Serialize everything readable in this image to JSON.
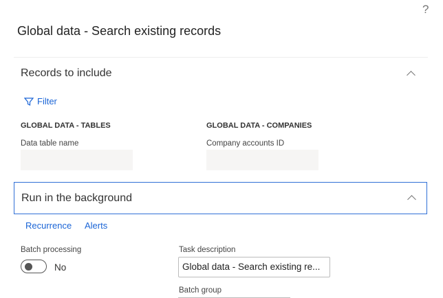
{
  "help_label": "?",
  "title": "Global data - Search existing records",
  "records": {
    "title": "Records to include",
    "filter": "Filter",
    "tables": {
      "group": "GLOBAL DATA - TABLES",
      "label": "Data table name",
      "value": ""
    },
    "companies": {
      "group": "GLOBAL DATA - COMPANIES",
      "label": "Company accounts ID",
      "value": ""
    }
  },
  "background": {
    "title": "Run in the background",
    "recurrence": "Recurrence",
    "alerts": "Alerts",
    "batch_label": "Batch processing",
    "batch_value": "No",
    "task_label": "Task description",
    "task_value": "Global data - Search existing re...",
    "group_label": "Batch group"
  }
}
